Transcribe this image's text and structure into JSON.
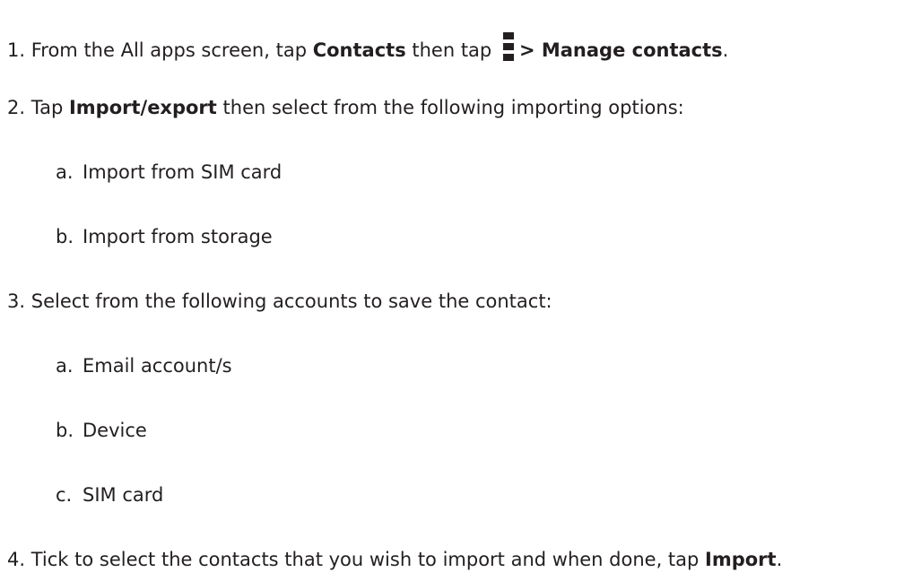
{
  "steps": [
    {
      "number": "1.",
      "parts": [
        "From the All apps screen, tap ",
        "Contacts",
        " then tap ",
        "> Manage contacts",
        "."
      ],
      "icon": "overflow-menu-icon"
    },
    {
      "number": "2.",
      "parts": [
        "Tap ",
        "Import/export",
        " then select from the following importing options:"
      ],
      "options": [
        {
          "letter": "a.",
          "text": "Import from SIM card"
        },
        {
          "letter": "b.",
          "text": "Import from storage"
        }
      ]
    },
    {
      "number": "3.",
      "text": "Select from the following accounts to save the contact:",
      "options": [
        {
          "letter": "a.",
          "text": "Email account/s"
        },
        {
          "letter": "b.",
          "text": "Device"
        },
        {
          "letter": "c.",
          "text": "SIM card"
        }
      ]
    },
    {
      "number": "4.",
      "parts": [
        "Tick to select the contacts that you wish to import and when done, tap ",
        "Import",
        "."
      ]
    }
  ]
}
